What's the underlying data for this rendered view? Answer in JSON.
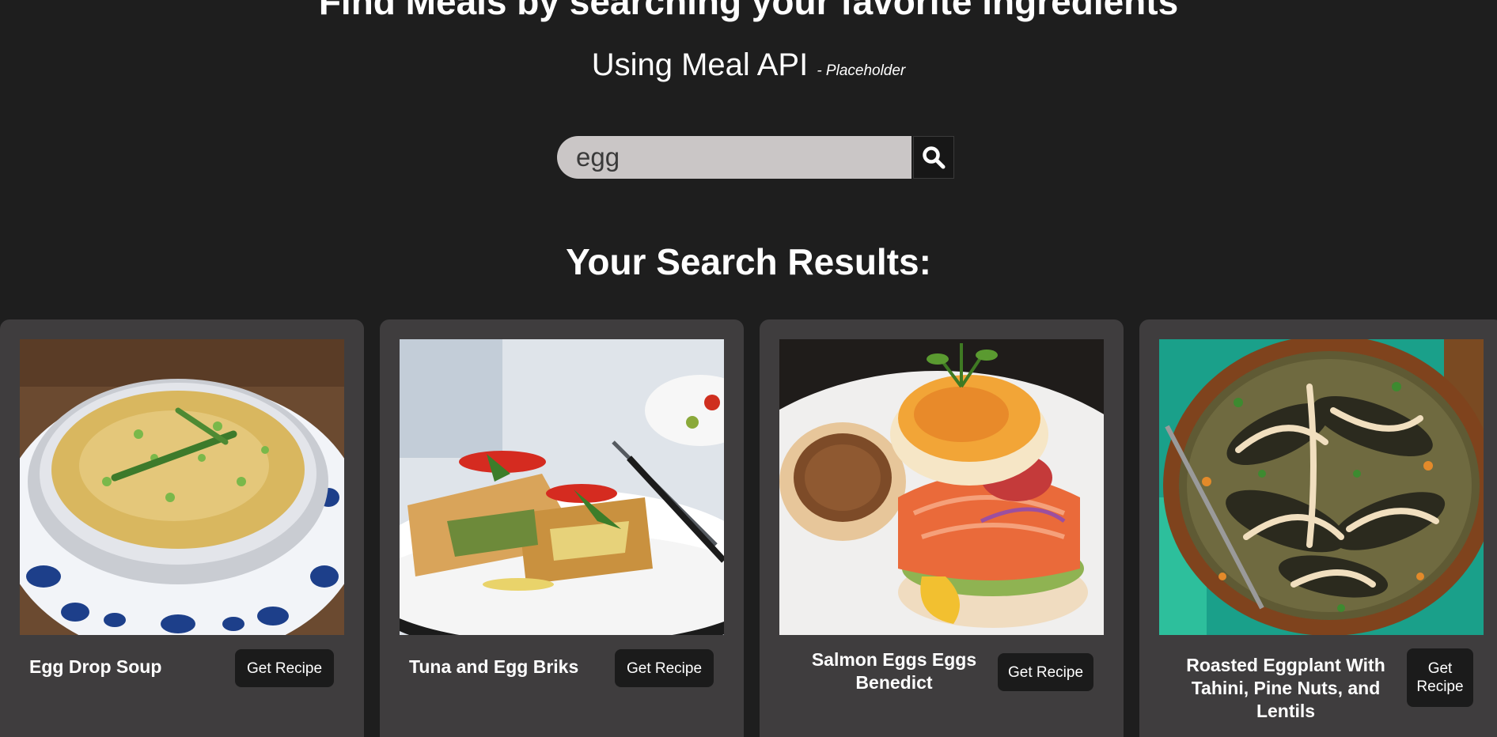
{
  "header": {
    "title": "Find Meals by searching your favorite ingredients",
    "subtitle": "Using Meal API",
    "subtitle_note": "- Placeholder"
  },
  "search": {
    "value": "egg",
    "button_icon": "search-icon"
  },
  "results": {
    "heading": "Your Search Results:",
    "button_label": "Get Recipe",
    "meals": [
      {
        "name": "Egg Drop Soup"
      },
      {
        "name": "Tuna and Egg Briks"
      },
      {
        "name": "Salmon Eggs Eggs Benedict"
      },
      {
        "name": "Roasted Eggplant With Tahini, Pine Nuts, and Lentils"
      }
    ]
  },
  "colors": {
    "background": "#1e1e1e",
    "card": "#3f3d3e",
    "button": "#1b1b1b",
    "search_field": "#cac6c6"
  }
}
